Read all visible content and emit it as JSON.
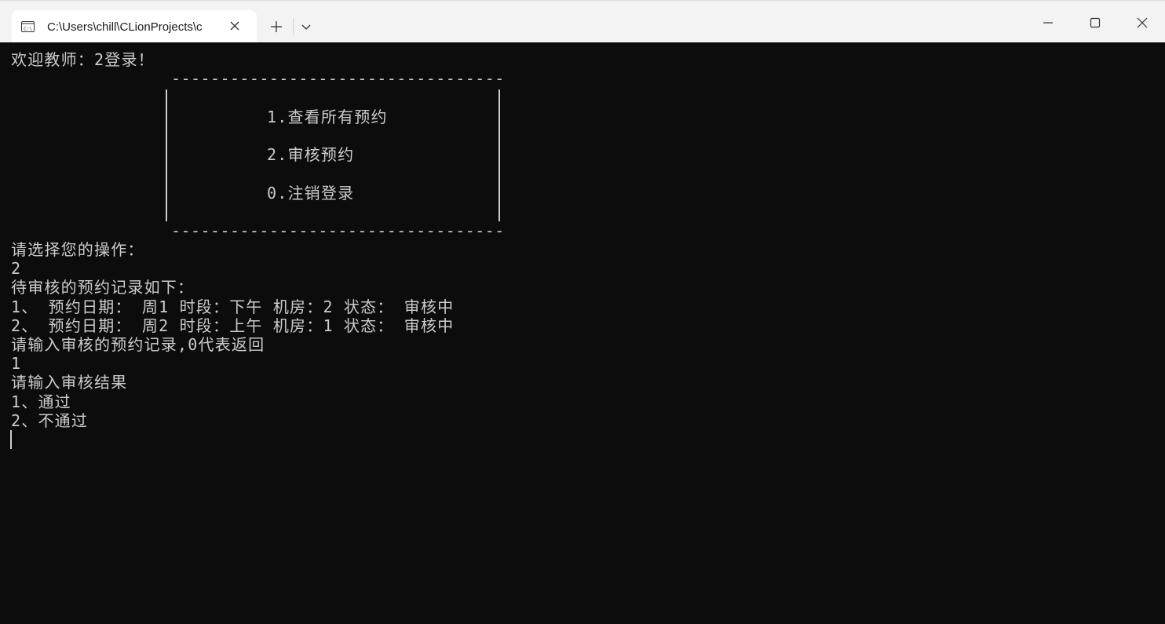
{
  "window": {
    "tab_title": "C:\\Users\\chill\\CLionProjects\\c",
    "icons": {
      "tab_icon": "console-icon",
      "tab_close": "close-icon",
      "new_tab": "plus-icon",
      "dropdown": "chevron-down-icon",
      "minimize": "minimize-icon",
      "maximize": "maximize-icon",
      "close": "close-icon"
    },
    "colors": {
      "titlebar": "#f3f3f3",
      "console_bg": "#0c0c0c",
      "console_text": "#cccccc"
    }
  },
  "console": {
    "welcome": "欢迎教师：2登录！",
    "menu_border": "----------------------------------",
    "menu_items": [
      "1.查看所有预约",
      "2.审核预约",
      "0.注销登录"
    ],
    "prompt_choose": "请选择您的操作：",
    "input_choice": "2",
    "pending_header": "待审核的预约记录如下：",
    "records": [
      "1、 预约日期： 周1 时段：下午 机房：2 状态： 审核中",
      "2、 预约日期： 周2 时段：上午 机房：1 状态： 审核中"
    ],
    "prompt_record": "请输入审核的预约记录,0代表返回",
    "input_record": "1",
    "prompt_result": "请输入审核结果",
    "options": [
      "1、通过",
      "2、不通过"
    ]
  }
}
